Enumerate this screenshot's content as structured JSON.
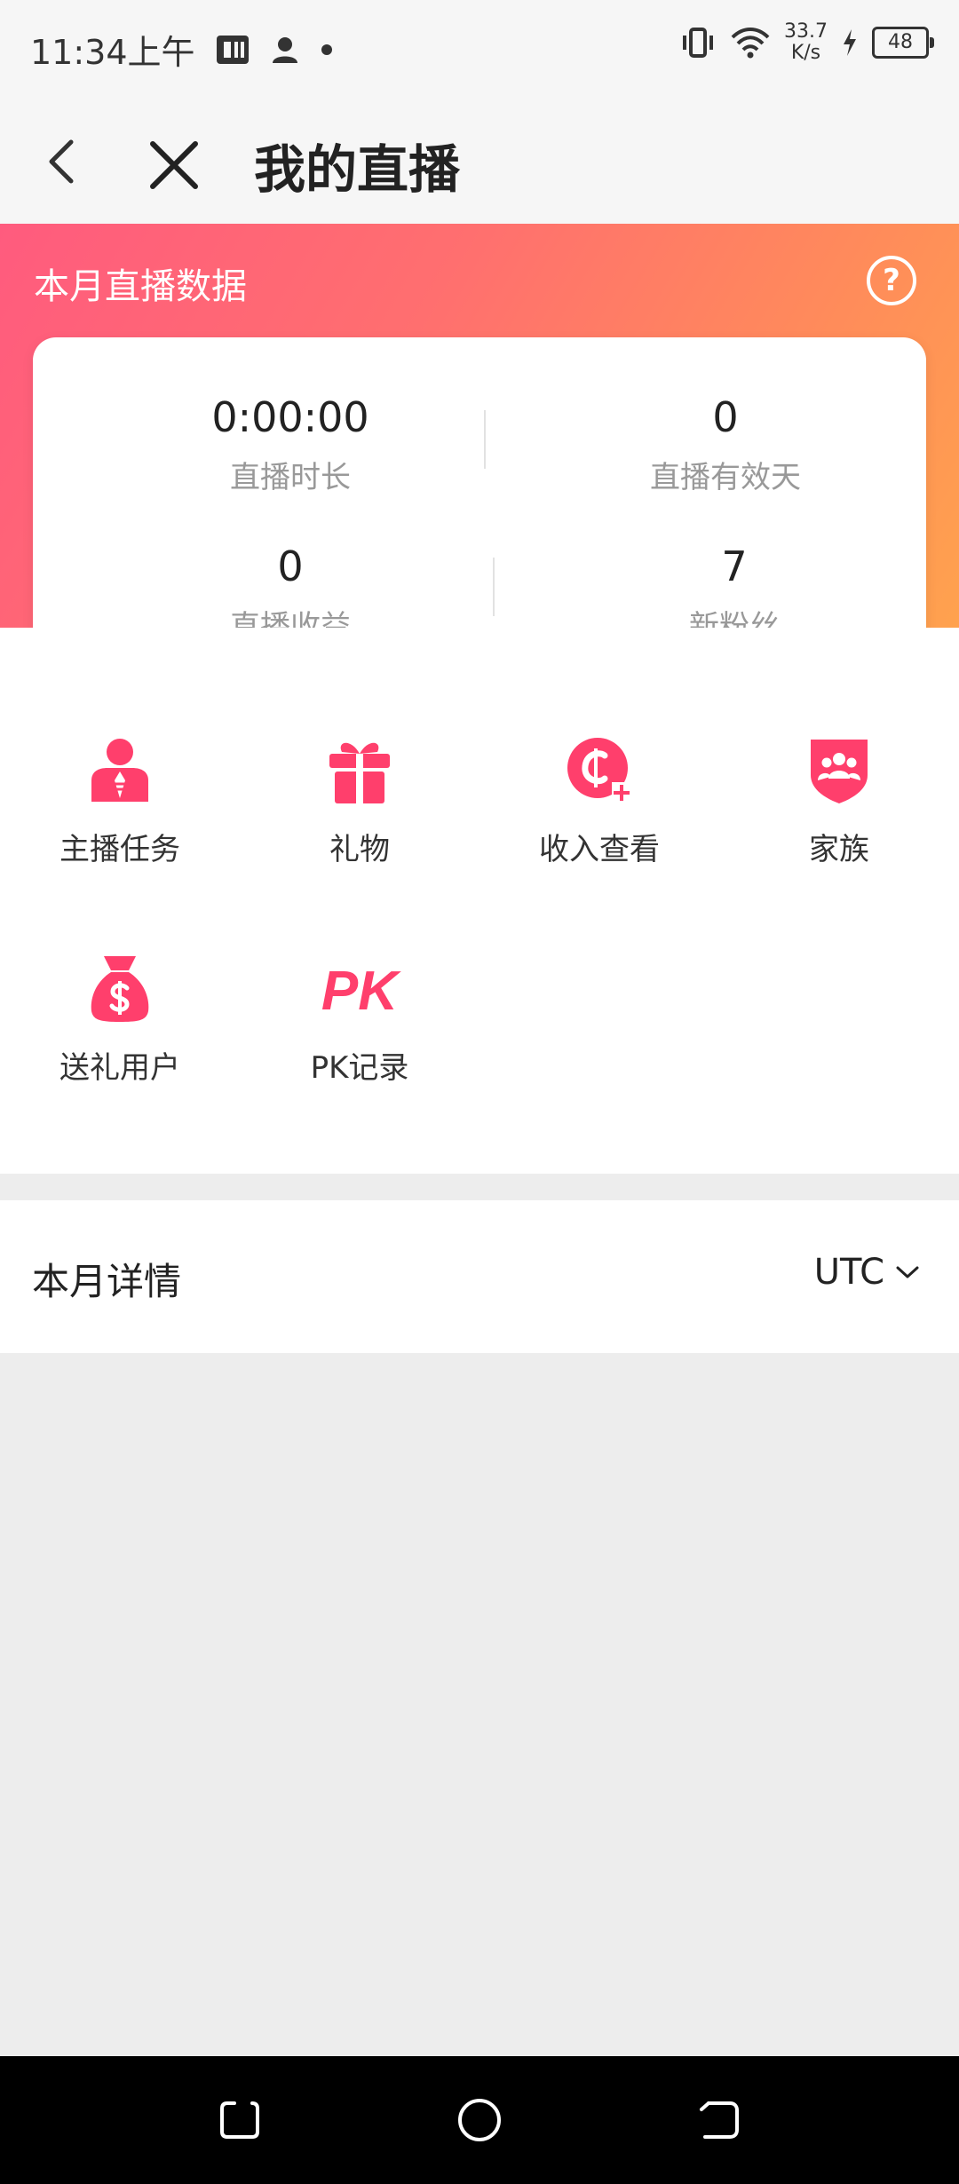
{
  "status_bar": {
    "time": "11:34上午",
    "speed_value": "33.7",
    "speed_unit": "K/s",
    "battery": "48"
  },
  "header": {
    "title": "我的直播"
  },
  "hero": {
    "title": "本月直播数据",
    "stats": [
      {
        "value": "0:00:00",
        "label": "直播时长"
      },
      {
        "value": "0",
        "label": "直播有效天"
      },
      {
        "value": "0",
        "label": "直播收益"
      },
      {
        "value": "7",
        "label": "新粉丝"
      }
    ]
  },
  "functions": [
    {
      "label": "主播任务",
      "icon": "anchor-task-icon"
    },
    {
      "label": "礼物",
      "icon": "gift-icon"
    },
    {
      "label": "收入查看",
      "icon": "income-icon"
    },
    {
      "label": "家族",
      "icon": "family-icon"
    },
    {
      "label": "送礼用户",
      "icon": "money-bag-icon"
    },
    {
      "label": "PK记录",
      "icon": "pk-icon"
    }
  ],
  "pk_icon_text": "PK",
  "details": {
    "title": "本月详情",
    "timezone": "UTC"
  },
  "colors": {
    "accent": "#ff3f6c",
    "hero_gradient_start": "#ff5b7e",
    "hero_gradient_end": "#ffa24e"
  }
}
